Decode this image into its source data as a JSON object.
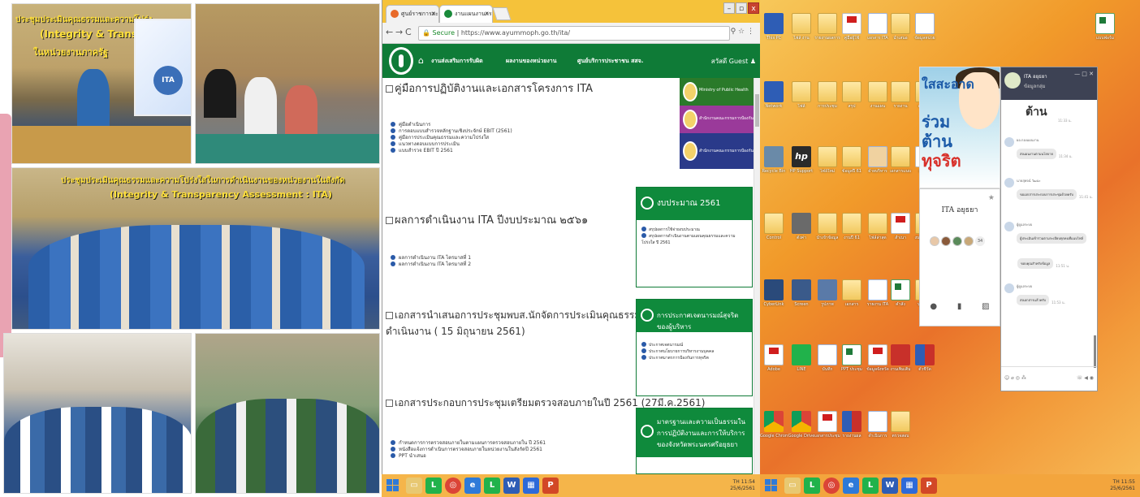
{
  "collage": {
    "banner_line1": "ประชุมประเมินคุณธรรมและความโปร่ง",
    "banner_line2": "(Integrity & Transparency",
    "banner_line3": "ในหน่วยงานภาครัฐ",
    "group_banner": "ประชุมประเมินคุณธรรมและความโปร่งใสในการดำเนินงานของหน่วยงานในสังกัด",
    "group_banner2": "(Integrity & Transparency Assessment : ITA)",
    "projector_badge": "ITA"
  },
  "browser": {
    "tabs": [
      {
        "label": "ศูนย์ราชการสะดวกได้ครับ",
        "favicon_color": "#e86a2a"
      },
      {
        "label": "งานแผนงานกรมสุข...เข้าถึง",
        "favicon_color": "#1a8a3a"
      }
    ],
    "window_buttons": {
      "minimize": "–",
      "maximize": "▫",
      "close": "x"
    },
    "address": {
      "secure_label": "Secure",
      "url": "https://www.ayummoph.go.th/ita/"
    },
    "nav_links": [
      "งานส่งเสริมการรับผิด",
      "ผลงานของหน่วยงาน",
      "ศูนย์บริการประชาชน สสจ."
    ],
    "user_greeting": "สวัสดี Guest",
    "sections": [
      {
        "title": "คู่มือการปฏิบัติงานและเอกสารโครงการ ITA",
        "docs": [
          "คู่มือดำเนินการ",
          "การตอบแบบสำรวจหลักฐานเชิงประจักษ์ EBIT (2561)",
          "คู่มือการประเมินคุณธรรมและความโปร่งใส",
          "แนวทางตอบแบบการประเมิน",
          "แบบสำรวจ EBIT ปี 2561"
        ]
      },
      {
        "title": "ผลการดำเนินงาน ITA ปีงบประมาณ ๒๕๖๑",
        "docs": [
          "ผลการดำเนินงาน ITA ไตรมาสที่ 1",
          "ผลการดำเนินงาน ITA ไตรมาสที่ 2"
        ]
      },
      {
        "title_line1": "เอกสารนำเสนอการประชุมพบส.นักจัดการประเมินคุณธรรมและความโปร่งใสในการ",
        "title_line2": "ดำเนินงาน ( 15 มิถุนายน 2561)",
        "docs": []
      },
      {
        "title": "เอกสารประกอบการประชุมเตรียมตรวจสอบภายในปี 2561 (27มี.ค.2561)",
        "docs": [
          "กำหนดการการตรวจสอบภายในตามแผนการตรวจสอบภายใน ปี 2561",
          "หนังสือแจ้งการดำเนินการตรวจสอบภายในหน่วยงานในสังกัดปี 2561",
          "PPT นำเสนอ"
        ]
      }
    ],
    "banners": [
      {
        "text": "Ministry of Public Health",
        "color": "#2a7a2a"
      },
      {
        "text": "สำนักงานคณะกรรมการป้องกันและปราบปรามการทุจริต",
        "color": "#9a3a9a"
      },
      {
        "text": "สำนักงานคณะกรรมการป้องกันและปราบปรามการทุจริตในภาครัฐ",
        "color": "#2a3a8a"
      }
    ],
    "sideboxes": [
      {
        "title": "งบประมาณ 2561",
        "items": [
          "สรุปผลการใช้จ่ายงบประมาณ",
          "สรุปผลการดำเนินงานตามแผนคุณธรรมและความโปร่งใส ปี 2561"
        ]
      },
      {
        "title": "การประกาศเจตนารมณ์สุจริตของผู้บริหาร",
        "items": [
          "ประกาศเจตนารมณ์",
          "ประกาศนโยบายการบริหารงานบุคคล",
          "ประกาศมาตรการป้องกันการทุจริต"
        ]
      },
      {
        "title": "มาตรฐานและความเป็นธรรมในการปฏิบัติงานและการให้บริการของจังหวัดพระนครศรีอยุธยา",
        "items": []
      }
    ]
  },
  "taskbar_mid": {
    "tray_time": "11:54",
    "tray_date": "25/6/2561",
    "tray_lang": "TH"
  },
  "taskbar_right": {
    "tray_time": "11:55",
    "tray_date": "25/6/2561",
    "tray_lang": "TH"
  },
  "desktop": {
    "icons_row1": [
      "This PC",
      "ไฟล์ งาน",
      "รายงานผลการ",
      "คู่มือผู้ใช้",
      "เอกสาร ITA",
      "นำเสนอ",
      "ข้อมูลหน่วย",
      "แบบฟอร์ม"
    ],
    "icons_row2": [
      "Network",
      "ไฟล์",
      "การประชุม",
      "สรุป",
      "งานแผน",
      "รายงาน",
      "เอกสาร"
    ],
    "icons_row3": [
      "Recycle Bin",
      "HP Support",
      "ไฟล์ใหม่",
      "ข้อมูลปี 61",
      "ฝ่ายบริหาร",
      "เอกสารแนบ",
      "สรุปผล"
    ],
    "icons_row4": [
      "Control",
      "ตั้งค่า",
      "นำเข้าข้อมูล",
      "งานปี 61",
      "ไฟล์ล่าสุด",
      "สำเนา",
      "งบประมาณ"
    ],
    "icons_row5": [
      "CyberLink",
      "Screen",
      "รูปภาพ",
      "เอกสาร",
      "รายงาน ITA",
      "คำสั่ง",
      "นโยบาย"
    ],
    "icons_row6": [
      "Adobe",
      "LINE",
      "บันทึก",
      "PPT ประชุม",
      "ข้อมูลจังหวัด",
      "งานเพิ่มเติม",
      "ตัวชี้วัด"
    ],
    "icons_row7": [
      "Google Chrome",
      "Google Drive",
      "เอกสารประชุม",
      "รายงานผล",
      "ดำเนินการ",
      "ตรวจสอบ"
    ],
    "poster_text1": "ใสสะอาด",
    "poster_text2": "ร่วม",
    "poster_text3": "ต้าน",
    "poster_text4": "ทุจริต",
    "group_name": "ITA อยุธยา",
    "group_count": "34",
    "chat": {
      "title": "ITA อยุธยา",
      "subtitle": "ข้อมูลกลุ่ม",
      "banner_word": "ต้าน",
      "messages": [
        {
          "name": "",
          "text": "",
          "time": "11:33 น."
        },
        {
          "name": "ผอ.กองแผนงาน",
          "text": "ส่งแผนงานตามนโยบาย",
          "time": "11:34 น."
        },
        {
          "name": "นายสุพจน์ วัฒนะ",
          "text": "ขอเอกสารประกอบการประชุมด้วยครับ",
          "time": "11:41 น."
        },
        {
          "name": "ผู้ดูแลระบบ",
          "text": "ผู้ประเมินเข้าร่วมตามระเบียบทุกคนที่แนบไฟล์",
          "time": ""
        },
        {
          "name": "",
          "text": "ขอบคุณสำหรับข้อมูล",
          "time": "11:51 น."
        },
        {
          "name": "ผู้ดูแลระบบ",
          "text": "ส่งเอกสารแล้วครับ",
          "time": "11:53 น."
        }
      ],
      "footer_icons": "☺ ⌀ ◎ ⁂",
      "send_icons": "☏ ◀ ◉"
    }
  }
}
